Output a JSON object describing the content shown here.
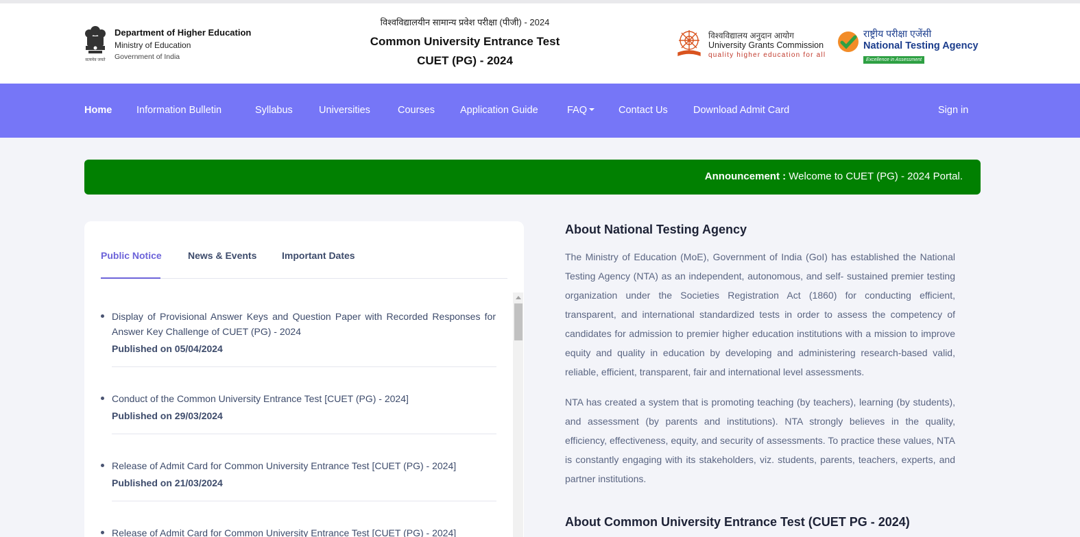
{
  "header": {
    "dept_line1": "Department of Higher Education",
    "dept_line2": "Ministry of Education",
    "dept_line3": "Government of India",
    "emblem_caption": "सत्यमेव जयते",
    "hindi_title": "विश्वविद्यालयीन सामान्य प्रवेश परीक्षा (पीजी) - 2024",
    "title_line1": "Common University Entrance Test",
    "title_line2": "CUET (PG) - 2024",
    "ugc_hindi": "विश्वविद्यालय अनुदान आयोग",
    "ugc_english": "University Grants Commission",
    "ugc_tagline": "quality higher education for all",
    "nta_hindi": "राष्ट्रीय परीक्षा एजेंसी",
    "nta_english": "National Testing Agency",
    "nta_tagline": "Excellence in Assessment"
  },
  "nav": {
    "items": [
      {
        "label": "Home"
      },
      {
        "label": "Information Bulletin"
      },
      {
        "label": "Syllabus"
      },
      {
        "label": "Universities"
      },
      {
        "label": "Courses"
      },
      {
        "label": "Application Guide"
      },
      {
        "label": "FAQ"
      },
      {
        "label": "Contact Us"
      },
      {
        "label": "Download Admit Card"
      }
    ],
    "sign_in": "Sign in"
  },
  "announcement": {
    "label": "Announcement :",
    "text": " Welcome to CUET (PG) - 2024 Portal."
  },
  "tabs": [
    {
      "label": "Public Notice"
    },
    {
      "label": "News & Events"
    },
    {
      "label": "Important Dates"
    }
  ],
  "notices": [
    {
      "title": "Display of Provisional Answer Keys and Question Paper with Recorded Responses for Answer Key Challenge of CUET (PG) - 2024",
      "published": "Published on 05/04/2024"
    },
    {
      "title": "Conduct of the Common University Entrance Test [CUET (PG) - 2024]",
      "published": "Published on 29/03/2024"
    },
    {
      "title": "Release of Admit Card for Common University Entrance Test [CUET (PG) - 2024]",
      "published": "Published on 21/03/2024"
    },
    {
      "title": "Release of Admit Card for Common University Entrance Test [CUET (PG) - 2024]",
      "published": ""
    }
  ],
  "about": {
    "heading": "About National Testing Agency",
    "para1": "The Ministry of Education (MoE), Government of India (GoI) has established the National Testing Agency (NTA) as an independent, autonomous, and self- sustained premier testing organization under the Societies Registration Act (1860) for conducting efficient, transparent, and international standardized tests in order to assess the competency of candidates for admission to premier higher education institutions with a mission to improve equity and quality in education by developing and administering research-based valid, reliable, efficient, transparent, fair and international level assessments.",
    "para2": "NTA has created a system that is promoting teaching (by teachers), learning (by students), and assessment (by parents and institutions). NTA strongly believes in the quality, efficiency, effectiveness, equity, and security of assessments. To practice these values, NTA is constantly engaging with its stakeholders, viz. students, parents, teachers, experts, and partner institutions.",
    "heading2": "About Common University Entrance Test (CUET PG - 2024)"
  },
  "colors": {
    "nav_bg": "#7676f7",
    "announcement_bg": "#018001",
    "active_tab": "#6c63d9",
    "page_bg": "#f3f4f9"
  }
}
